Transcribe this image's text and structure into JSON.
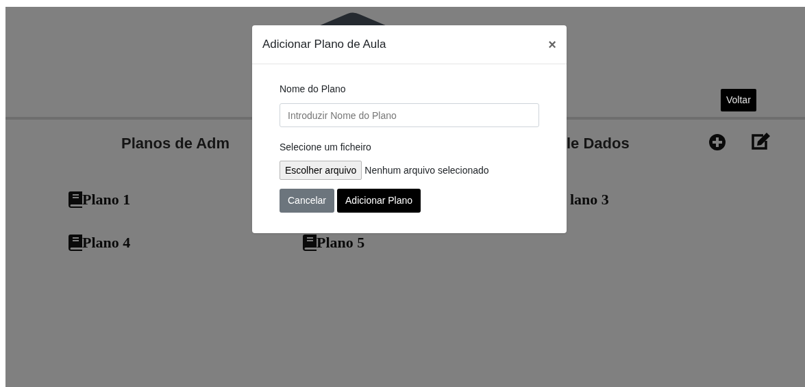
{
  "page": {
    "back_button": "Voltar",
    "heading_left": "Planos de Adm",
    "heading_right": "le Dados",
    "plans": [
      {
        "kind": "plan",
        "label": "Plano 1"
      },
      {
        "kind": "fragment",
        "label": "lano 3"
      },
      {
        "kind": "plan",
        "label": "Plano 4"
      },
      {
        "kind": "plan",
        "label": "Plano 5"
      }
    ]
  },
  "modal": {
    "title": "Adicionar Plano de Aula",
    "close": "×",
    "name_label": "Nome do Plano",
    "name_placeholder": "Introduzir Nome do Plano",
    "file_label": "Selecione um ficheiro",
    "file_button": "Escolher arquivo",
    "file_status": "Nenhum arquivo selecionado",
    "buttons": [
      {
        "kind": "secondary",
        "label": "Cancelar"
      },
      {
        "kind": "primary",
        "label": "Adicionar Plano"
      }
    ]
  }
}
